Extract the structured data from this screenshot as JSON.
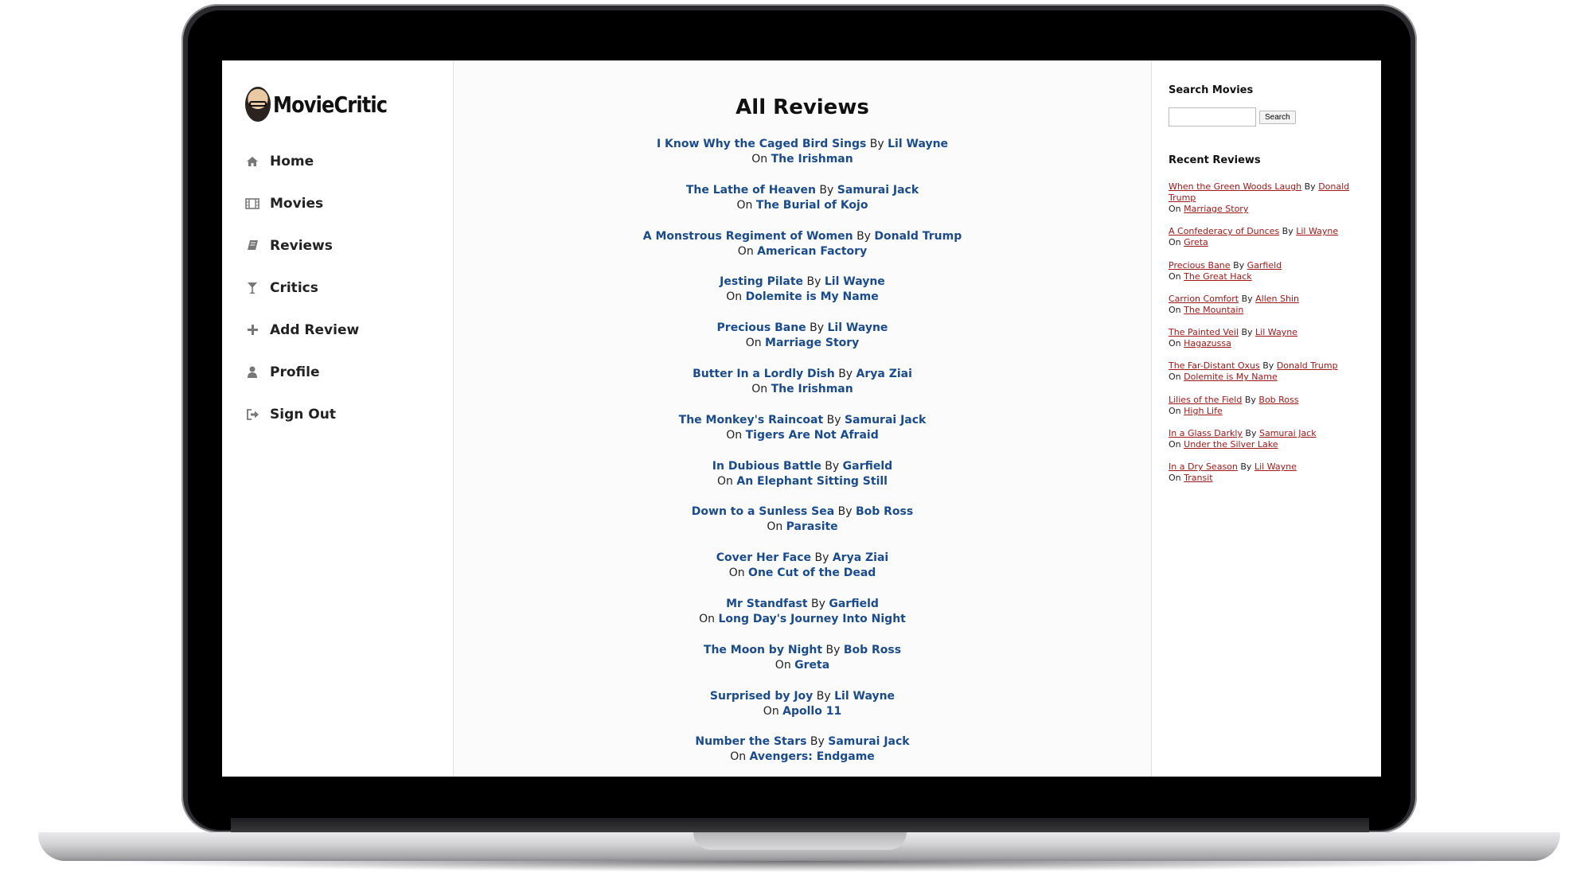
{
  "app": {
    "brand": "MovieCritic"
  },
  "nav": [
    {
      "label": "Home",
      "icon": "home-icon"
    },
    {
      "label": "Movies",
      "icon": "film-icon"
    },
    {
      "label": "Reviews",
      "icon": "book-icon"
    },
    {
      "label": "Critics",
      "icon": "cocktail-glass-icon"
    },
    {
      "label": "Add Review",
      "icon": "plus-icon"
    },
    {
      "label": "Profile",
      "icon": "user-icon"
    },
    {
      "label": "Sign Out",
      "icon": "sign-out-icon"
    }
  ],
  "main": {
    "title": "All Reviews",
    "by": "By",
    "on": "On",
    "reviews": [
      {
        "title": "I Know Why the Caged Bird Sings",
        "author": "Lil Wayne",
        "movie": "The Irishman"
      },
      {
        "title": "The Lathe of Heaven",
        "author": "Samurai Jack",
        "movie": "The Burial of Kojo"
      },
      {
        "title": "A Monstrous Regiment of Women",
        "author": "Donald Trump",
        "movie": "American Factory"
      },
      {
        "title": "Jesting Pilate",
        "author": "Lil Wayne",
        "movie": "Dolemite is My Name"
      },
      {
        "title": "Precious Bane",
        "author": "Lil Wayne",
        "movie": "Marriage Story"
      },
      {
        "title": "Butter In a Lordly Dish",
        "author": "Arya Ziai",
        "movie": "The Irishman"
      },
      {
        "title": "The Monkey's Raincoat",
        "author": "Samurai Jack",
        "movie": "Tigers Are Not Afraid"
      },
      {
        "title": "In Dubious Battle",
        "author": "Garfield",
        "movie": "An Elephant Sitting Still"
      },
      {
        "title": "Down to a Sunless Sea",
        "author": "Bob Ross",
        "movie": "Parasite"
      },
      {
        "title": "Cover Her Face",
        "author": "Arya Ziai",
        "movie": "One Cut of the Dead"
      },
      {
        "title": "Mr Standfast",
        "author": "Garfield",
        "movie": "Long Day's Journey Into Night"
      },
      {
        "title": "The Moon by Night",
        "author": "Bob Ross",
        "movie": "Greta"
      },
      {
        "title": "Surprised by Joy",
        "author": "Lil Wayne",
        "movie": "Apollo 11"
      },
      {
        "title": "Number the Stars",
        "author": "Samurai Jack",
        "movie": "Avengers: Endgame"
      }
    ]
  },
  "right": {
    "search_heading": "Search Movies",
    "search_value": "",
    "search_button": "Search",
    "recent_heading": "Recent Reviews",
    "by": "By",
    "on": "On",
    "recent": [
      {
        "title": "When the Green Woods Laugh",
        "author": "Donald Trump",
        "movie": "Marriage Story"
      },
      {
        "title": "A Confederacy of Dunces",
        "author": "Lil Wayne",
        "movie": "Greta"
      },
      {
        "title": "Precious Bane",
        "author": "Garfield",
        "movie": "The Great Hack"
      },
      {
        "title": "Carrion Comfort",
        "author": "Allen Shin",
        "movie": "The Mountain"
      },
      {
        "title": "The Painted Veil",
        "author": "Lil Wayne",
        "movie": "Hagazussa"
      },
      {
        "title": "The Far-Distant Oxus",
        "author": "Donald Trump",
        "movie": "Dolemite is My Name"
      },
      {
        "title": "Lilies of the Field",
        "author": "Bob Ross",
        "movie": "High Life"
      },
      {
        "title": "In a Glass Darkly",
        "author": "Samurai Jack",
        "movie": "Under the Silver Lake"
      },
      {
        "title": "In a Dry Season",
        "author": "Lil Wayne",
        "movie": "Transit"
      }
    ]
  },
  "colors": {
    "link": "#1a4b8c",
    "recent_link": "#a01818"
  }
}
